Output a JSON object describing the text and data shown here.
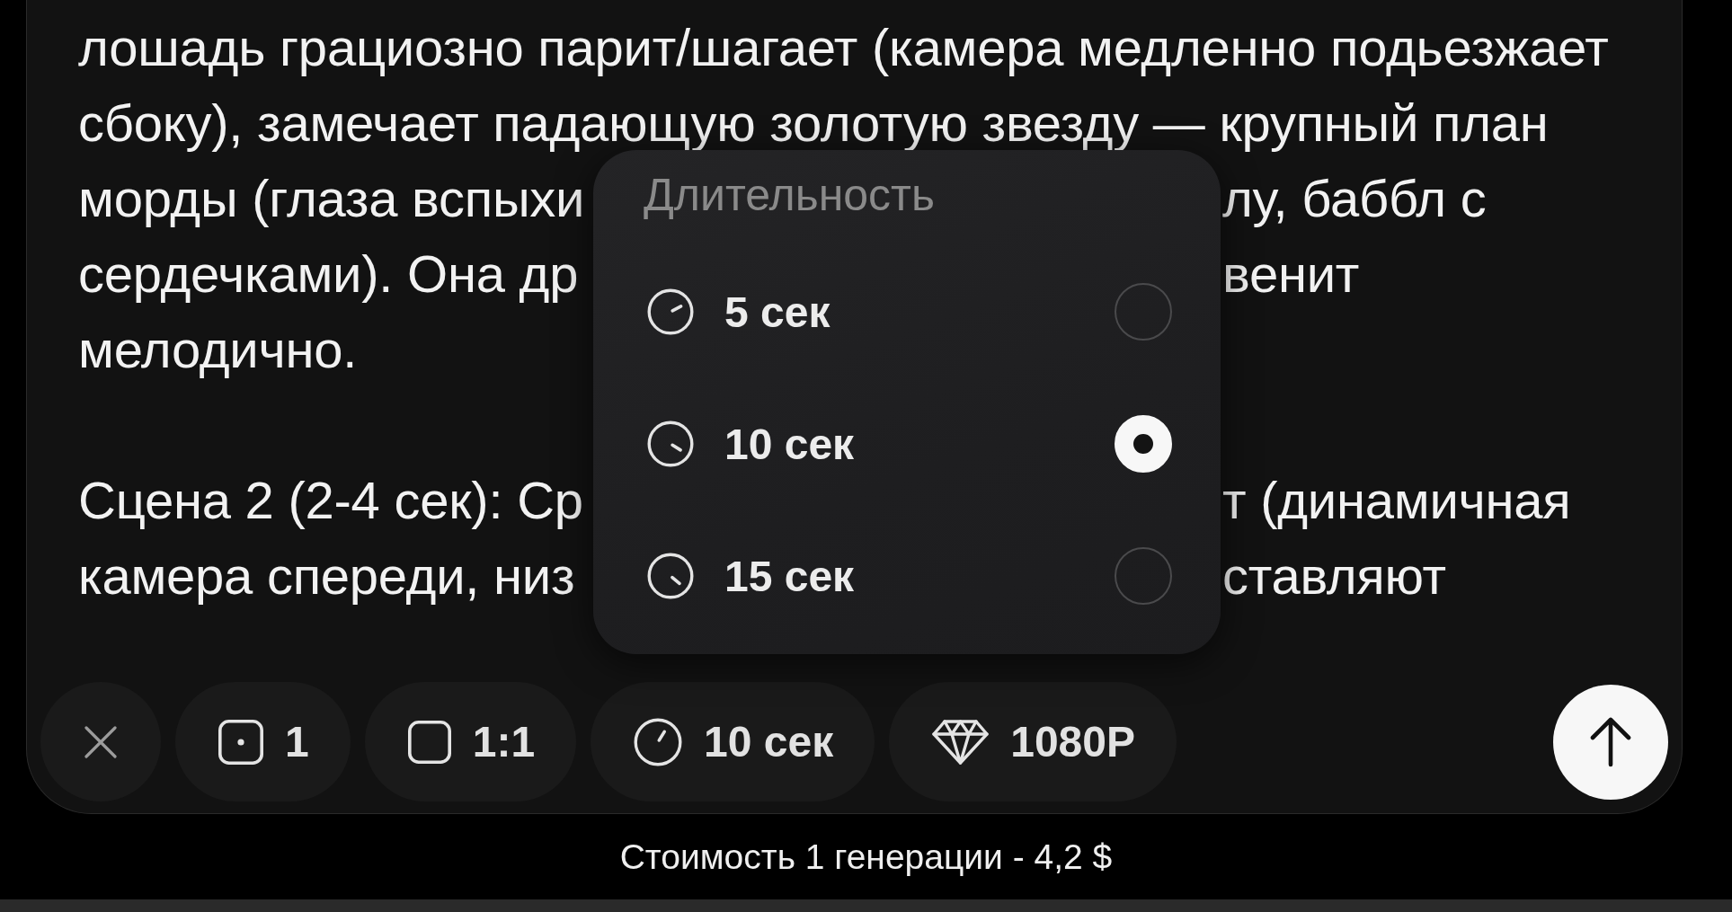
{
  "prompt": {
    "paragraphs": [
      {
        "lines": [
          [
            "лошадь грациозно парит/шагает (камера медленно подьезжает"
          ],
          [
            "сбоку), замечает падающую золотую звезду — крупный план"
          ],
          [
            "морды (глаза вспыхи",
            "лу, баббл с"
          ],
          [
            "сердечками). Она др",
            "венит"
          ],
          [
            "мелодично."
          ]
        ]
      },
      {
        "lines": [
          [
            "Сцена 2 (2-4 сек): Ср",
            "т (динамичная"
          ],
          [
            "камера спереди, низ",
            "ставляют"
          ]
        ]
      }
    ]
  },
  "duration_menu": {
    "title": "Длительность",
    "options": [
      {
        "label": "5 сек",
        "selected": false
      },
      {
        "label": "10 сек",
        "selected": true
      },
      {
        "label": "15 сек",
        "selected": false
      }
    ]
  },
  "toolbar": {
    "chips": [
      {
        "kind": "count",
        "label": "1"
      },
      {
        "kind": "aspect",
        "label": "1:1"
      },
      {
        "kind": "duration",
        "label": "10 сек"
      },
      {
        "kind": "quality",
        "label": "1080P"
      }
    ]
  },
  "cost_note": "Стоимость 1 генерации - 4,2 $"
}
